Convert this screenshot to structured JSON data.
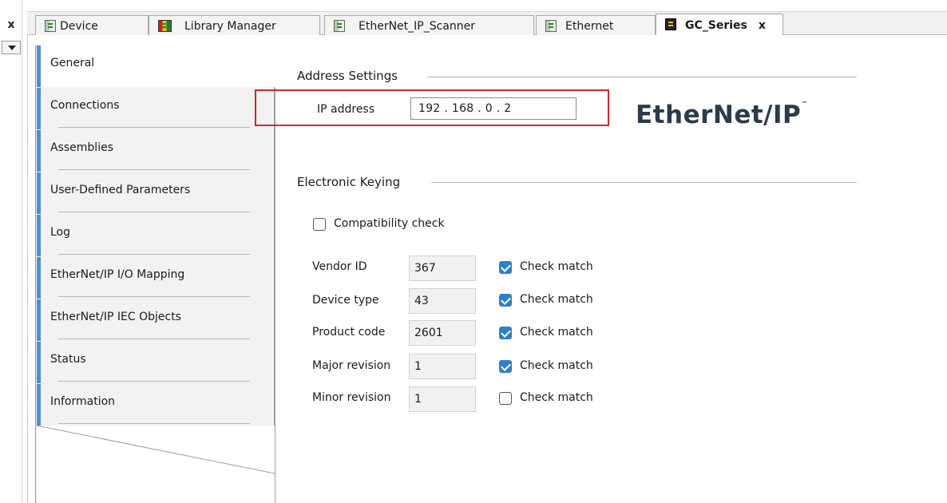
{
  "tabs": [
    {
      "label": "Device",
      "icon": "device-module-icon"
    },
    {
      "label": "Library Manager",
      "icon": "library-books-icon"
    },
    {
      "label": "EtherNet_IP_Scanner",
      "icon": "device-module-icon"
    },
    {
      "label": "Ethernet",
      "icon": "device-module-icon"
    },
    {
      "label": "GC_Series",
      "icon": "gc-series-device-icon",
      "active": true,
      "close": "x"
    }
  ],
  "gutter": {
    "close": "x"
  },
  "nav": {
    "items": [
      {
        "label": "General",
        "active": true
      },
      {
        "label": "Connections"
      },
      {
        "label": "Assemblies"
      },
      {
        "label": "User-Defined Parameters"
      },
      {
        "label": "Log"
      },
      {
        "label": "EtherNet/IP I/O Mapping"
      },
      {
        "label": "EtherNet/IP IEC Objects"
      },
      {
        "label": "Status"
      },
      {
        "label": "Information"
      }
    ]
  },
  "address": {
    "title": "Address Settings",
    "ip_label": "IP address",
    "ip_value": "192 . 168 . 0 . 2"
  },
  "logo": {
    "text": "EtherNet/IP",
    "tm": "™"
  },
  "keying": {
    "title": "Electronic Keying",
    "compat_label": "Compatibility check",
    "compat_checked": false,
    "rows": [
      {
        "label": "Vendor ID",
        "value": "367",
        "check_label": "Check match",
        "checked": true
      },
      {
        "label": "Device type",
        "value": "43",
        "check_label": "Check match",
        "checked": true
      },
      {
        "label": "Product code",
        "value": "2601",
        "check_label": "Check match",
        "checked": true
      },
      {
        "label": "Major revision",
        "value": "1",
        "check_label": "Check match",
        "checked": true
      },
      {
        "label": "Minor revision",
        "value": "1",
        "check_label": "Check match",
        "checked": false
      }
    ]
  },
  "colors": {
    "accent": "#4a90d9",
    "highlight": "#d12828",
    "check": "#2f7fc6"
  }
}
